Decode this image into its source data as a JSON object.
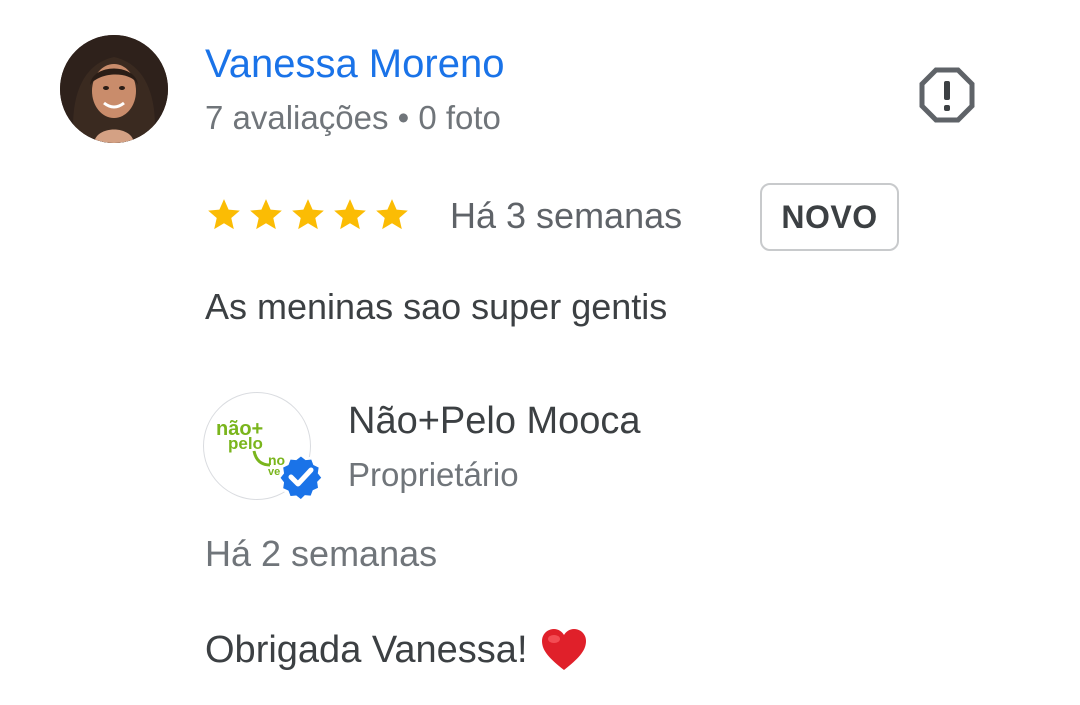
{
  "review": {
    "reviewer": {
      "name": "Vanessa Moreno",
      "meta": "7 avaliações • 0 foto"
    },
    "report_icon": "flag-report-icon",
    "rating": 5,
    "time_ago": "Há 3 semanas",
    "badge": "NOVO",
    "text": "As meninas sao super gentis"
  },
  "reply": {
    "owner": {
      "name": "Não+Pelo Mooca",
      "role": "Proprietário",
      "logo_text_top": "não+\npelo",
      "logo_text_bottom": "no\nve",
      "verified_icon": "verified-badge-icon"
    },
    "time_ago": "Há 2 semanas",
    "text": "Obrigada Vanessa!",
    "emoji": "heart-icon"
  },
  "colors": {
    "link": "#1a73e8",
    "star": "#fbbc04",
    "verified": "#1a73e8",
    "brand_green": "#7ab51d",
    "heart": "#e0202a"
  }
}
